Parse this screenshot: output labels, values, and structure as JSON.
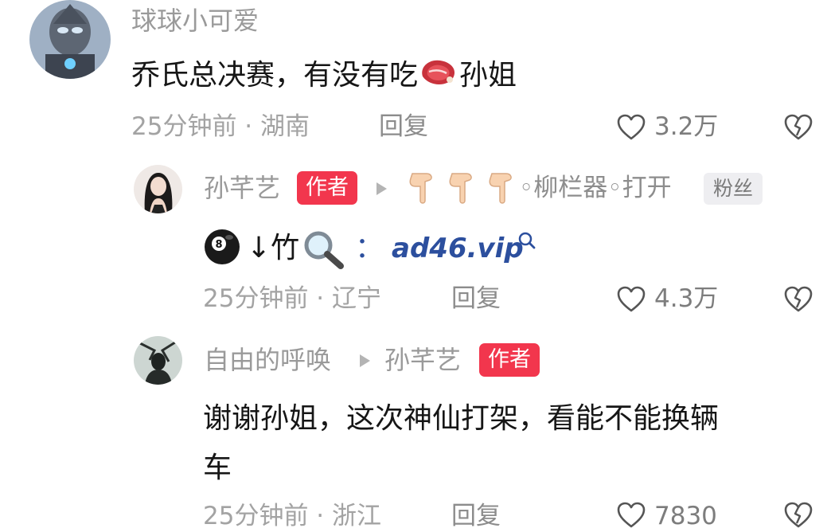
{
  "comments": [
    {
      "username": "球球小可爱",
      "text_before_emoji": "乔氏总决赛，有没有吃",
      "emoji": "steak-icon",
      "text_after_emoji": "孙姐",
      "meta": "25分钟前 · 湖南",
      "reply_label": "回复",
      "likes": "3.2万"
    },
    {
      "username": "孙芊艺",
      "badge": "作者",
      "note": "👇🏻👇🏻👇🏻◦̥̥̥柳̥̥̥栏̥̥̥器̥̥̥◦̥̥̥打开",
      "note_emoji": "pointing-down-hand-icon",
      "note_text": "◦柳栏器◦打开",
      "fan_badge": "粉丝",
      "body_emoji_1": "8-ball-icon",
      "body_arrow": "↓竹",
      "body_emoji_2": "magnifier-icon",
      "colon": "：",
      "link_text": "ad46.vip",
      "meta": "25分钟前 · 辽宁",
      "reply_label": "回复",
      "likes": "4.3万"
    },
    {
      "username": "自由的呼唤",
      "reply_to": "孙芊艺",
      "reply_to_badge": "作者",
      "text_line1": "谢谢孙姐，这次神仙打架，看能不能换辆",
      "text_line2": "车",
      "meta_partial": "25分钟前 · 浙江",
      "reply_label_partial": "回复",
      "likes_partial": "7830"
    }
  ],
  "colors": {
    "author_badge": "#f2364d",
    "link": "#2c4f9e",
    "muted_text": "#a3a3a3"
  }
}
